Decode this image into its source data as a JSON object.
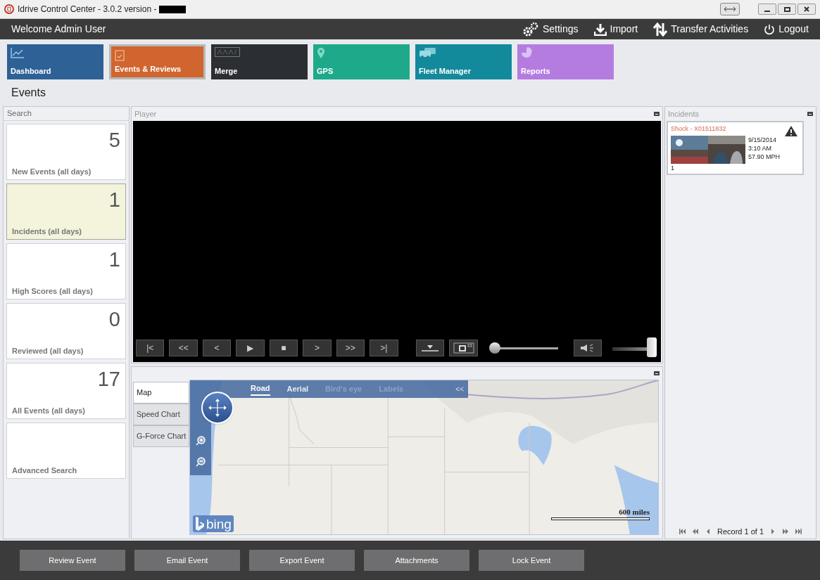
{
  "window": {
    "title": "Idrive Control Center - 3.0.2 version -"
  },
  "topbar": {
    "welcome": "Welcome Admin User",
    "actions": [
      {
        "kind": "settings",
        "label": "Settings"
      },
      {
        "kind": "import",
        "label": "Import"
      },
      {
        "kind": "transfer",
        "label": "Transfer Activities"
      },
      {
        "kind": "logout",
        "label": "Logout"
      }
    ]
  },
  "modules": [
    {
      "kind": "dashboard",
      "label": "Dashboard",
      "color": "#2e6196",
      "selected": false
    },
    {
      "kind": "events",
      "label": "Events & Reviews",
      "color": "#d0652f",
      "selected": true
    },
    {
      "kind": "merge",
      "label": "Merge",
      "color": "#2b2e33",
      "selected": false
    },
    {
      "kind": "gps",
      "label": "GPS",
      "color": "#1ea98b",
      "selected": false
    },
    {
      "kind": "fleet",
      "label": "Fleet Manager",
      "color": "#138a9c",
      "selected": false
    },
    {
      "kind": "reports",
      "label": "Reports",
      "color": "#b57ce0",
      "selected": false
    }
  ],
  "page_title": "Events",
  "search_panel": {
    "title": "Search",
    "cards": [
      {
        "count": "5",
        "label": "New Events (all days)",
        "selected": false
      },
      {
        "count": "1",
        "label": "Incidents (all days)",
        "selected": true
      },
      {
        "count": "1",
        "label": "High Scores (all days)",
        "selected": false
      },
      {
        "count": "0",
        "label": "Reviewed (all days)",
        "selected": false
      },
      {
        "count": "17",
        "label": "All Events (all days)",
        "selected": false
      },
      {
        "label": "Advanced Search",
        "selected": false
      }
    ]
  },
  "player": {
    "title": "Player",
    "buttons": [
      "|<",
      "<<",
      "<",
      "▶",
      "■",
      ">",
      ">>",
      ">|"
    ],
    "seek": {
      "level": 0
    },
    "volume": {
      "level": 1
    }
  },
  "chart_panel": {
    "tabs": [
      {
        "label": "Map",
        "selected": true
      },
      {
        "label": "Speed Chart",
        "selected": false
      },
      {
        "label": "G-Force Chart",
        "selected": false
      }
    ],
    "map": {
      "kind": "picture",
      "modes": [
        {
          "label": "Road",
          "selected": true,
          "disabled": false
        },
        {
          "label": "Aerial",
          "selected": false,
          "disabled": false
        },
        {
          "label": "Bird's eye",
          "selected": false,
          "disabled": true
        },
        {
          "label": "Labels",
          "selected": false,
          "disabled": true
        }
      ],
      "collapse": "<<",
      "brand": "bing",
      "scale": "600 miles"
    }
  },
  "incidents": {
    "title": "Incidents",
    "items": [
      {
        "title": "Shock - X01511832",
        "date": "9/15/2014",
        "time": "3:10 AM",
        "speed": "57.90 MPH",
        "number": "1"
      }
    ],
    "pager": "Record 1 of 1"
  },
  "actions": [
    "Review Event",
    "Email Event",
    "Export Event",
    "Attachments",
    "Lock Event"
  ]
}
